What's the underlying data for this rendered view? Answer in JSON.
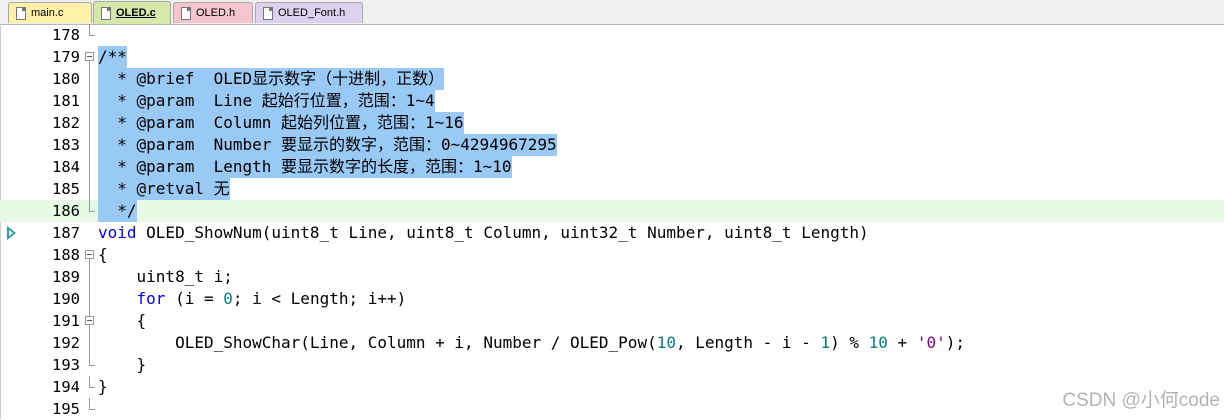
{
  "tabs": [
    {
      "label": "main.c",
      "color": "#fff1a8"
    },
    {
      "label": "OLED.c",
      "color": "#d6e9a9"
    },
    {
      "label": "OLED.h",
      "color": "#f6c5cf"
    },
    {
      "label": "OLED_Font.h",
      "color": "#dcd2ee"
    }
  ],
  "current_line": "187",
  "lines": [
    {
      "num": "178",
      "text": ""
    },
    {
      "num": "179",
      "text": "/**"
    },
    {
      "num": "180",
      "text": "  * @brief  OLED显示数字（十进制，正数）"
    },
    {
      "num": "181",
      "text": "  * @param  Line 起始行位置，范围：1~4"
    },
    {
      "num": "182",
      "text": "  * @param  Column 起始列位置，范围：1~16"
    },
    {
      "num": "183",
      "text": "  * @param  Number 要显示的数字，范围：0~4294967295"
    },
    {
      "num": "184",
      "text": "  * @param  Length 要显示数字的长度，范围：1~10"
    },
    {
      "num": "185",
      "text": "  * @retval 无"
    },
    {
      "num": "186",
      "text": "  */"
    },
    {
      "num": "187",
      "kw": "void",
      "text": " OLED_ShowNum(uint8_t Line, uint8_t Column, uint32_t Number, uint8_t Length)"
    },
    {
      "num": "188",
      "text": "{"
    },
    {
      "num": "189",
      "text": "    uint8_t i;"
    },
    {
      "num": "190",
      "kw": "for",
      "a": " (i = ",
      "n1": "0",
      "b": "; i < Length; i++)"
    },
    {
      "num": "191",
      "text": "    {"
    },
    {
      "num": "192",
      "a": "        OLED_ShowChar(Line, Column + i, Number / OLED_Pow(",
      "n1": "10",
      "b": ", Length - i - ",
      "n2": "1",
      "c": ") % ",
      "n3": "10",
      "d": " + ",
      "s": "'0'",
      "e": ");"
    },
    {
      "num": "193",
      "text": "    }"
    },
    {
      "num": "194",
      "text": "}"
    },
    {
      "num": "195",
      "text": ""
    }
  ],
  "watermark": "CSDN @小何code"
}
